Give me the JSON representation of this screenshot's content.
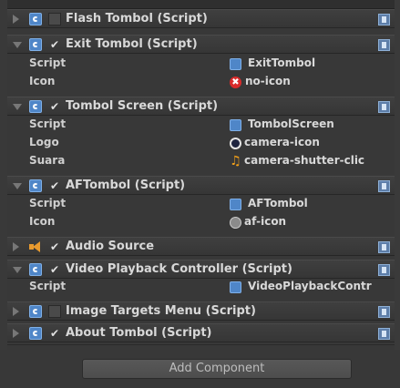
{
  "components": [
    {
      "title": "Flash Tombol (Script)",
      "checked": false,
      "expanded": false,
      "icon": "script-icon"
    },
    {
      "title": "Exit Tombol (Script)",
      "checked": true,
      "expanded": true,
      "icon": "script-icon",
      "fields": [
        {
          "label": "Script",
          "value": "ExitTombol",
          "icon": "script-icon"
        },
        {
          "label": "Icon",
          "value": "no-icon",
          "icon": "no-icon"
        }
      ]
    },
    {
      "title": "Tombol Screen (Script)",
      "checked": true,
      "expanded": true,
      "icon": "script-icon",
      "fields": [
        {
          "label": "Script",
          "value": "TombolScreen",
          "icon": "script-icon"
        },
        {
          "label": "Logo",
          "value": "camera-icon",
          "icon": "camera-icon"
        },
        {
          "label": "Suara",
          "value": "camera-shutter-clic",
          "icon": "audio-icon"
        }
      ]
    },
    {
      "title": "AFTombol (Script)",
      "checked": true,
      "expanded": true,
      "icon": "script-icon",
      "fields": [
        {
          "label": "Script",
          "value": "AFTombol",
          "icon": "script-icon"
        },
        {
          "label": "Icon",
          "value": "af-icon",
          "icon": "af-icon"
        }
      ]
    },
    {
      "title": "Audio Source",
      "checked": true,
      "expanded": false,
      "icon": "speaker-icon"
    },
    {
      "title": "Video Playback Controller (Script)",
      "checked": true,
      "expanded": true,
      "icon": "script-icon",
      "fields": [
        {
          "label": "Script",
          "value": "VideoPlaybackContr",
          "icon": "script-icon"
        }
      ]
    },
    {
      "title": "Image Targets Menu (Script)",
      "checked": false,
      "expanded": false,
      "icon": "script-icon"
    },
    {
      "title": "About Tombol (Script)",
      "checked": true,
      "expanded": false,
      "icon": "script-icon"
    }
  ],
  "add_component_label": "Add Component",
  "checkmark": "✔",
  "no_icon_glyph": "✖",
  "shutter_glyph": "♫"
}
